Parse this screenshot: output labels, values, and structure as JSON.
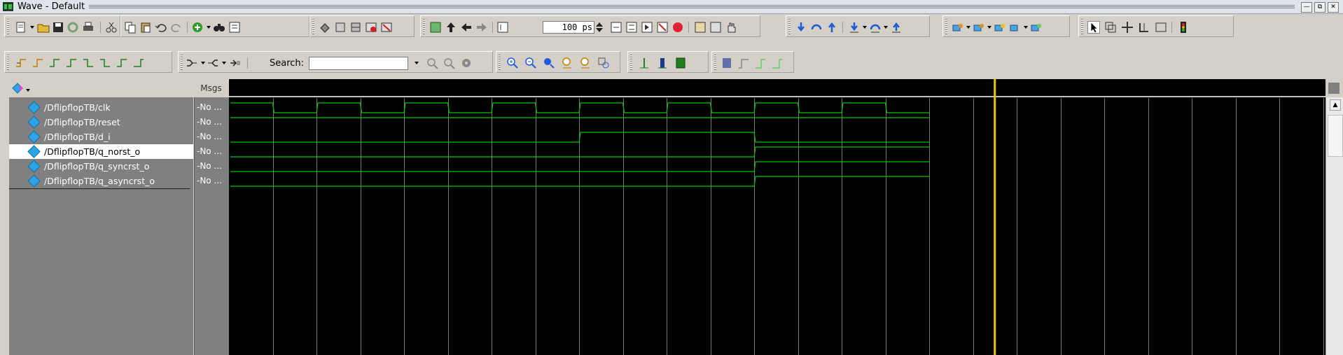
{
  "window": {
    "title": "Wave - Default",
    "buttons": [
      "—",
      "⧉",
      "✕"
    ]
  },
  "toolbar1": {
    "zoom_value": "100 ps"
  },
  "toolbar2": {
    "search_label": "Search:",
    "search_value": ""
  },
  "wave_header": {
    "msgs_label": "Msgs"
  },
  "signals": [
    {
      "name": "/DflipflopTB/clk",
      "msg": "-No ...",
      "selected": false
    },
    {
      "name": "/DflipflopTB/reset",
      "msg": "-No ...",
      "selected": false
    },
    {
      "name": "/DflipflopTB/d_i",
      "msg": "-No ...",
      "selected": false
    },
    {
      "name": "/DflipflopTB/q_norst_o",
      "msg": "-No ...",
      "selected": true
    },
    {
      "name": "/DflipflopTB/q_syncrst_o",
      "msg": "-No ...",
      "selected": false
    },
    {
      "name": "/DflipflopTB/q_asyncrst_o",
      "msg": "-No ...",
      "selected": false
    }
  ],
  "waveforms": {
    "num_periods": 32,
    "data_periods": 16,
    "cursor_period": 17.5,
    "traces": [
      [
        1,
        0,
        1,
        0,
        1,
        0,
        1,
        0,
        1,
        0,
        1,
        0,
        1,
        0,
        1,
        0,
        1,
        0,
        1,
        0,
        1,
        0,
        1,
        0,
        1,
        0,
        1,
        0,
        1,
        0,
        1,
        0
      ],
      [
        1,
        1,
        1,
        1,
        1,
        1,
        1,
        1,
        1,
        1,
        1,
        1,
        1,
        1,
        1,
        1,
        1,
        1,
        1,
        1,
        1,
        1,
        1,
        1,
        1,
        1,
        1,
        1,
        1,
        1,
        1,
        1
      ],
      [
        0,
        0,
        0,
        0,
        0,
        0,
        0,
        0,
        1,
        1,
        1,
        1,
        0,
        0,
        0,
        0,
        0,
        0,
        0,
        0,
        1,
        1,
        1,
        1,
        1,
        1,
        1,
        1,
        0,
        0,
        0,
        0
      ],
      [
        0,
        0,
        0,
        0,
        0,
        0,
        0,
        0,
        0,
        0,
        0,
        0,
        1,
        1,
        1,
        1,
        0,
        0,
        0,
        0,
        0,
        0,
        0,
        0,
        1,
        1,
        1,
        1,
        1,
        1,
        1,
        1
      ],
      [
        0,
        0,
        0,
        0,
        0,
        0,
        0,
        0,
        0,
        0,
        0,
        0,
        1,
        1,
        1,
        1,
        0,
        0,
        0,
        0,
        0,
        0,
        0,
        0,
        0,
        0,
        0,
        0,
        0,
        0,
        0,
        0
      ],
      [
        0,
        0,
        0,
        0,
        0,
        0,
        0,
        0,
        0,
        0,
        0,
        0,
        1,
        1,
        1,
        1,
        0,
        0,
        0,
        0,
        0,
        0,
        0,
        0,
        0,
        0,
        0,
        0,
        0,
        0,
        0,
        0
      ]
    ]
  },
  "colors": {
    "wave": "#00c800",
    "grid": "#7a7a7a",
    "cursor": "#f2c400",
    "background": "#000000"
  }
}
